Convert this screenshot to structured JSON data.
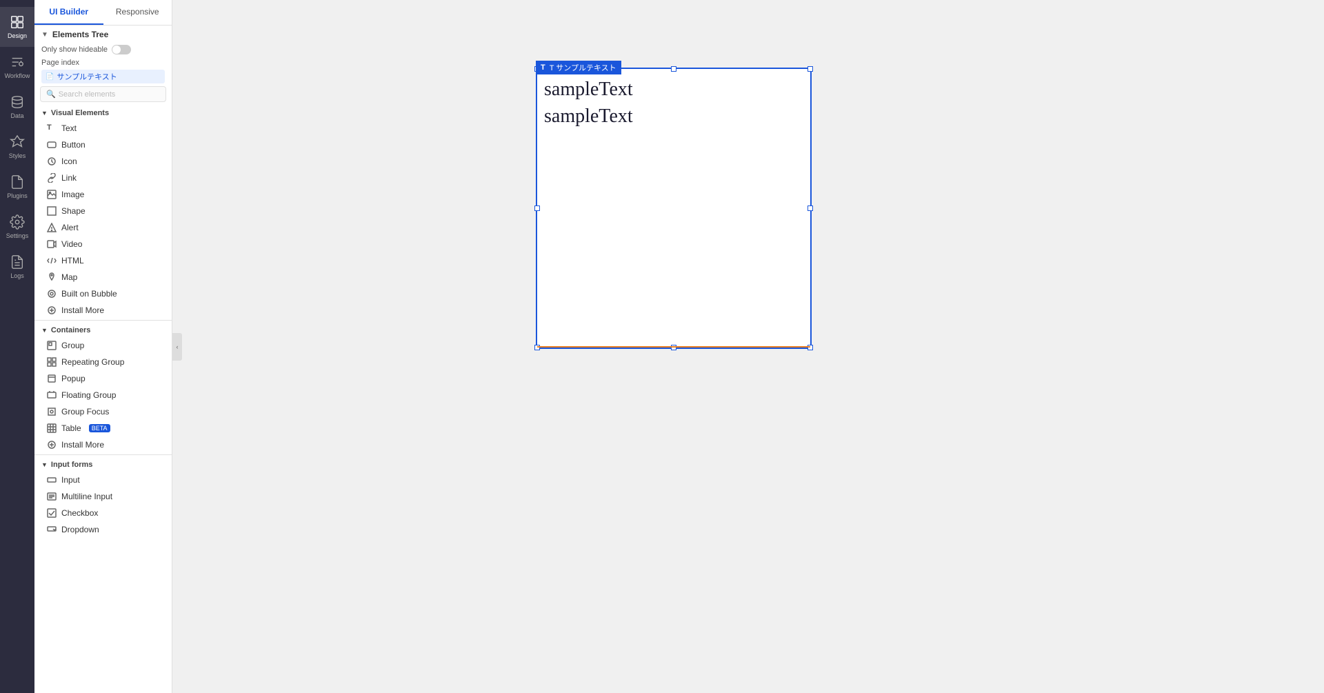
{
  "icon_sidebar": {
    "items": [
      {
        "id": "design",
        "label": "Design",
        "active": true
      },
      {
        "id": "workflow",
        "label": "Workflow",
        "active": false
      },
      {
        "id": "data",
        "label": "Data",
        "active": false
      },
      {
        "id": "styles",
        "label": "Styles",
        "active": false
      },
      {
        "id": "plugins",
        "label": "Plugins",
        "active": false
      },
      {
        "id": "settings",
        "label": "Settings",
        "active": false
      },
      {
        "id": "logs",
        "label": "Logs",
        "active": false
      }
    ]
  },
  "panel": {
    "tabs": [
      {
        "id": "ui-builder",
        "label": "UI Builder",
        "active": true
      },
      {
        "id": "responsive",
        "label": "Responsive",
        "active": false
      }
    ],
    "elements_tree": {
      "section_label": "Elements Tree",
      "only_show_label": "Only show hideable",
      "page_index_label": "Page index",
      "page_name": "サンプルテキスト",
      "search_placeholder": "Search elements"
    },
    "visual_elements": {
      "section_label": "Visual Elements",
      "items": [
        {
          "id": "text",
          "label": "Text",
          "icon": "text-icon"
        },
        {
          "id": "button",
          "label": "Button",
          "icon": "button-icon"
        },
        {
          "id": "icon",
          "label": "Icon",
          "icon": "icon-icon"
        },
        {
          "id": "link",
          "label": "Link",
          "icon": "link-icon"
        },
        {
          "id": "image",
          "label": "Image",
          "icon": "image-icon"
        },
        {
          "id": "shape",
          "label": "Shape",
          "icon": "shape-icon"
        },
        {
          "id": "alert",
          "label": "Alert",
          "icon": "alert-icon"
        },
        {
          "id": "video",
          "label": "Video",
          "icon": "video-icon"
        },
        {
          "id": "html",
          "label": "HTML",
          "icon": "html-icon"
        },
        {
          "id": "map",
          "label": "Map",
          "icon": "map-icon"
        },
        {
          "id": "built-on-bubble",
          "label": "Built on Bubble",
          "icon": "bubble-icon"
        },
        {
          "id": "install-more-1",
          "label": "Install More",
          "icon": "install-icon"
        }
      ]
    },
    "containers": {
      "section_label": "Containers",
      "items": [
        {
          "id": "group",
          "label": "Group",
          "icon": "group-icon"
        },
        {
          "id": "repeating-group",
          "label": "Repeating Group",
          "icon": "repeating-group-icon"
        },
        {
          "id": "popup",
          "label": "Popup",
          "icon": "popup-icon"
        },
        {
          "id": "floating-group",
          "label": "Floating Group",
          "icon": "floating-group-icon"
        },
        {
          "id": "group-focus",
          "label": "Group Focus",
          "icon": "group-focus-icon"
        },
        {
          "id": "table",
          "label": "Table",
          "icon": "table-icon",
          "badge": "BETA"
        },
        {
          "id": "install-more-2",
          "label": "Install More",
          "icon": "install-icon"
        }
      ]
    },
    "input_forms": {
      "section_label": "Input forms",
      "items": [
        {
          "id": "input",
          "label": "Input",
          "icon": "input-icon"
        },
        {
          "id": "multiline-input",
          "label": "Multiline Input",
          "icon": "multiline-icon"
        },
        {
          "id": "checkbox",
          "label": "Checkbox",
          "icon": "checkbox-icon"
        },
        {
          "id": "dropdown",
          "label": "Dropdown",
          "icon": "dropdown-icon"
        }
      ]
    }
  },
  "canvas": {
    "element_label": "T サンプルテキスト",
    "sample_text_line1": "sampleText",
    "sample_text_line2": "sampleText"
  }
}
